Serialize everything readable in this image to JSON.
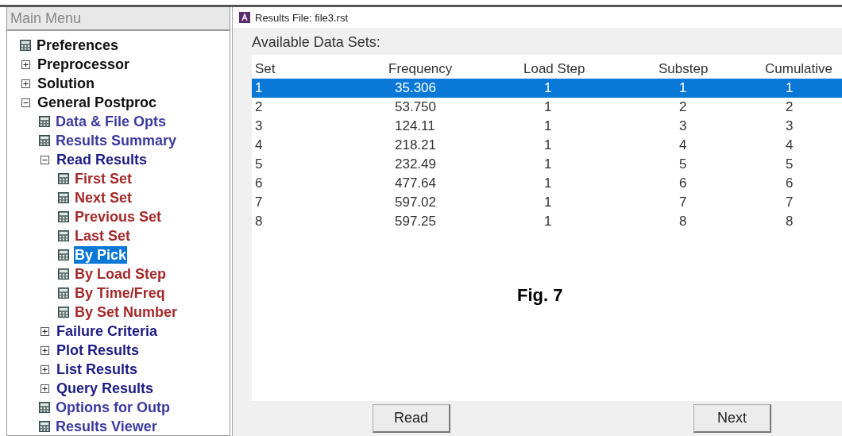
{
  "main_menu": {
    "title": "Main Menu",
    "items": [
      {
        "label": "Preferences",
        "kind": "leaf",
        "selected": false
      },
      {
        "label": "Preprocessor",
        "kind": "folder",
        "expanded": false,
        "selected": false
      },
      {
        "label": "Solution",
        "kind": "folder",
        "expanded": false,
        "selected": false
      },
      {
        "label": "General Postproc",
        "kind": "folder",
        "expanded": true,
        "selected": false,
        "children": [
          {
            "label": "Data & File Opts",
            "kind": "leaf",
            "selected": false
          },
          {
            "label": "Results Summary",
            "kind": "leaf",
            "selected": false
          },
          {
            "label": "Read Results",
            "kind": "folder",
            "expanded": true,
            "selected": false,
            "children": [
              {
                "label": "First Set",
                "kind": "leaf",
                "selected": false
              },
              {
                "label": "Next Set",
                "kind": "leaf",
                "selected": false
              },
              {
                "label": "Previous Set",
                "kind": "leaf",
                "selected": false
              },
              {
                "label": "Last Set",
                "kind": "leaf",
                "selected": false
              },
              {
                "label": "By Pick",
                "kind": "leaf",
                "selected": true
              },
              {
                "label": "By Load Step",
                "kind": "leaf",
                "selected": false
              },
              {
                "label": "By Time/Freq",
                "kind": "leaf",
                "selected": false
              },
              {
                "label": "By Set Number",
                "kind": "leaf",
                "selected": false
              }
            ]
          },
          {
            "label": "Failure Criteria",
            "kind": "folder",
            "expanded": false,
            "selected": false
          },
          {
            "label": "Plot Results",
            "kind": "folder",
            "expanded": false,
            "selected": false
          },
          {
            "label": "List Results",
            "kind": "folder",
            "expanded": false,
            "selected": false
          },
          {
            "label": "Query Results",
            "kind": "folder",
            "expanded": false,
            "selected": false
          },
          {
            "label": "Options for Outp",
            "kind": "leaf",
            "selected": false
          },
          {
            "label": "Results Viewer",
            "kind": "leaf",
            "selected": false
          }
        ]
      }
    ]
  },
  "dialog": {
    "title": "Results File: file3.rst",
    "heading": "Available Data Sets:",
    "table": {
      "columns": [
        "Set",
        "Frequency",
        "Load Step",
        "Substep",
        "Cumulative"
      ],
      "rows": [
        {
          "cells": [
            "1",
            "35.306",
            "1",
            "1",
            "1"
          ],
          "selected": true
        },
        {
          "cells": [
            "2",
            "53.750",
            "1",
            "2",
            "2"
          ],
          "selected": false
        },
        {
          "cells": [
            "3",
            "124.11",
            "1",
            "3",
            "3"
          ],
          "selected": false
        },
        {
          "cells": [
            "4",
            "218.21",
            "1",
            "4",
            "4"
          ],
          "selected": false
        },
        {
          "cells": [
            "5",
            "232.49",
            "1",
            "5",
            "5"
          ],
          "selected": false
        },
        {
          "cells": [
            "6",
            "477.64",
            "1",
            "6",
            "6"
          ],
          "selected": false
        },
        {
          "cells": [
            "7",
            "597.02",
            "1",
            "7",
            "7"
          ],
          "selected": false
        },
        {
          "cells": [
            "8",
            "597.25",
            "1",
            "8",
            "8"
          ],
          "selected": false
        }
      ]
    },
    "caption": "Fig. 7",
    "buttons": [
      "Read",
      "Next"
    ]
  }
}
